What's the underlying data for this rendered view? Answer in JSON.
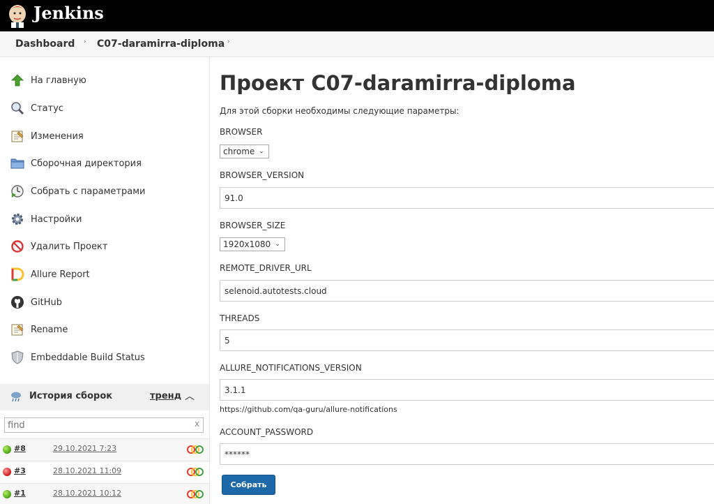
{
  "header": {
    "logo_text": "Jenkins"
  },
  "breadcrumb": {
    "items": [
      "Dashboard",
      "C07-daramirra-diploma"
    ]
  },
  "sidebar": {
    "tasks": [
      {
        "label": "На главную",
        "icon": "up-arrow-icon"
      },
      {
        "label": "Статус",
        "icon": "search-icon"
      },
      {
        "label": "Изменения",
        "icon": "notepad-icon"
      },
      {
        "label": "Сборочная директория",
        "icon": "folder-icon"
      },
      {
        "label": "Собрать с параметрами",
        "icon": "clock-play-icon"
      },
      {
        "label": "Настройки",
        "icon": "gear-icon"
      },
      {
        "label": "Удалить Проект",
        "icon": "no-entry-icon"
      },
      {
        "label": "Allure Report",
        "icon": "allure-icon"
      },
      {
        "label": "GitHub",
        "icon": "github-icon"
      },
      {
        "label": "Rename",
        "icon": "notepad-icon"
      },
      {
        "label": "Embeddable Build Status",
        "icon": "shield-icon"
      }
    ]
  },
  "history": {
    "title": "История сборок",
    "trend": "тренд",
    "filter_placeholder": "find",
    "filter_clear": "x",
    "builds": [
      {
        "number": "#8",
        "date": "29.10.2021 7:23",
        "status": "success"
      },
      {
        "number": "#3",
        "date": "28.10.2021 11:09",
        "status": "failed"
      },
      {
        "number": "#1",
        "date": "28.10.2021 10:12",
        "status": "success"
      }
    ]
  },
  "main": {
    "title": "Проект C07-daramirra-diploma",
    "description": "Для этой сборки необходимы следующие параметры:",
    "params": {
      "browser": {
        "name": "BROWSER",
        "value": "chrome"
      },
      "browser_version": {
        "name": "BROWSER_VERSION",
        "value": "91.0"
      },
      "browser_size": {
        "name": "BROWSER_SIZE",
        "value": "1920x1080"
      },
      "remote_driver_url": {
        "name": "REMOTE_DRIVER_URL",
        "value": "selenoid.autotests.cloud"
      },
      "threads": {
        "name": "THREADS",
        "value": "5"
      },
      "allure_notifications_version": {
        "name": "ALLURE_NOTIFICATIONS_VERSION",
        "value": "3.1.1",
        "hint": "https://github.com/qa-guru/allure-notifications"
      },
      "account_password": {
        "name": "ACCOUNT_PASSWORD",
        "value": "******"
      }
    },
    "build_button": "Собрать"
  }
}
